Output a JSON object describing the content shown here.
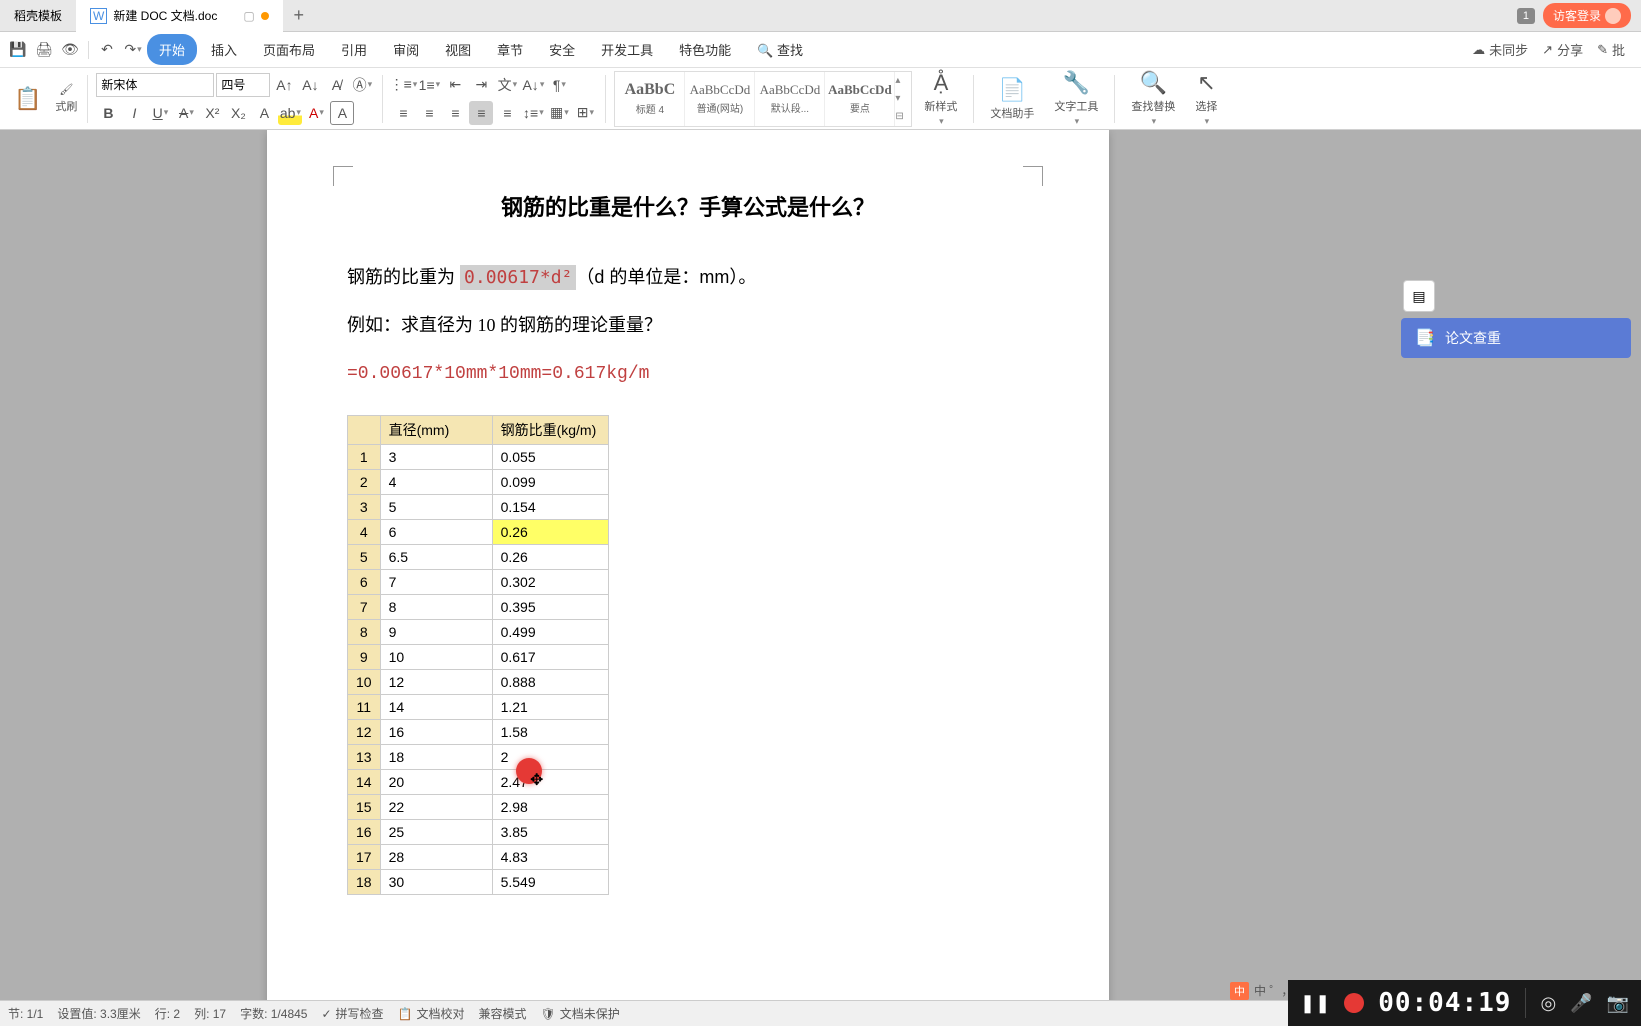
{
  "tabs": {
    "tab1": "稻壳模板",
    "tab2": "新建 DOC 文档.doc",
    "count_badge": "1",
    "login": "访客登录"
  },
  "menu": {
    "start": "开始",
    "insert": "插入",
    "page_layout": "页面布局",
    "reference": "引用",
    "review": "审阅",
    "view": "视图",
    "chapter": "章节",
    "security": "安全",
    "dev_tools": "开发工具",
    "special": "特色功能",
    "find": "查找",
    "unsync": "未同步",
    "share": "分享",
    "annotate": "批"
  },
  "ribbon": {
    "format_painter": "式刷",
    "font_name": "新宋体",
    "font_size": "四号",
    "styles": {
      "s1_preview": "AaBbC",
      "s1_name": "标题 4",
      "s2_preview": "AaBbCcDd",
      "s2_name": "普通(网站)",
      "s3_preview": "AaBbCcDd",
      "s3_name": "默认段...",
      "s4_preview": "AaBbCcDd",
      "s4_name": "要点"
    },
    "new_style": "新样式",
    "doc_assist": "文档助手",
    "text_tools": "文字工具",
    "find_replace": "查找替换",
    "select": "选择"
  },
  "doc": {
    "title": "钢筋的比重是什么？手算公式是什么？",
    "para1_pre": "钢筋的比重为 ",
    "formula": "0.00617*d²",
    "para1_post": "（d 的单位是：mm）。",
    "para2": "例如：求直径为 10 的钢筋的理论重量？",
    "para3": "=0.00617*10mm*10mm=0.617kg/m",
    "table": {
      "header1": "直径(mm)",
      "header2": "钢筋比重(kg/m)",
      "rows": [
        {
          "n": "1",
          "d": "3",
          "w": "0.055"
        },
        {
          "n": "2",
          "d": "4",
          "w": "0.099"
        },
        {
          "n": "3",
          "d": "5",
          "w": "0.154"
        },
        {
          "n": "4",
          "d": "6",
          "w": "0.26",
          "hl": true
        },
        {
          "n": "5",
          "d": "6.5",
          "w": "0.26"
        },
        {
          "n": "6",
          "d": "7",
          "w": "0.302"
        },
        {
          "n": "7",
          "d": "8",
          "w": "0.395"
        },
        {
          "n": "8",
          "d": "9",
          "w": "0.499"
        },
        {
          "n": "9",
          "d": "10",
          "w": "0.617"
        },
        {
          "n": "10",
          "d": "12",
          "w": "0.888"
        },
        {
          "n": "11",
          "d": "14",
          "w": "1.21"
        },
        {
          "n": "12",
          "d": "16",
          "w": "1.58"
        },
        {
          "n": "13",
          "d": "18",
          "w": "2"
        },
        {
          "n": "14",
          "d": "20",
          "w": "2.47"
        },
        {
          "n": "15",
          "d": "22",
          "w": "2.98"
        },
        {
          "n": "16",
          "d": "25",
          "w": "3.85"
        },
        {
          "n": "17",
          "d": "28",
          "w": "4.83"
        },
        {
          "n": "18",
          "d": "30",
          "w": "5.549"
        }
      ]
    }
  },
  "right_panel": {
    "paper_check": "论文查重"
  },
  "status": {
    "section": "节: 1/1",
    "set_value": "设置值: 3.3厘米",
    "row": "行: 2",
    "col": "列: 17",
    "word_count": "字数: 1/4845",
    "spell_check": "拼写检查",
    "doc_proof": "文档校对",
    "compat": "兼容模式",
    "unprotected": "文档未保护"
  },
  "recording": {
    "time": "00:04:19"
  },
  "ime": {
    "label": "中",
    "items": "中 ゜， ● 🎤 ⏷"
  }
}
